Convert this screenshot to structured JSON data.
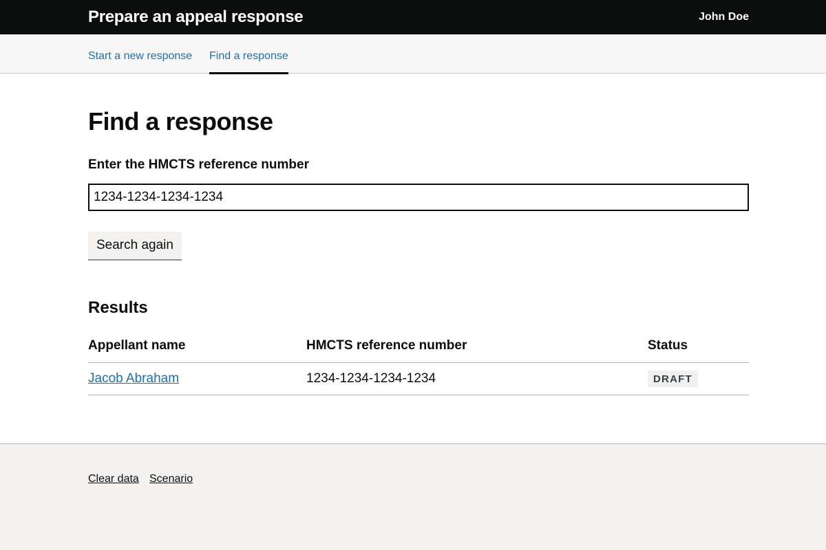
{
  "header": {
    "title": "Prepare an appeal response",
    "user_name": "John Doe"
  },
  "subnav": {
    "items": [
      {
        "label": "Start a new response",
        "active": false
      },
      {
        "label": "Find a response",
        "active": true
      }
    ]
  },
  "main": {
    "title": "Find a response",
    "search": {
      "label": "Enter the HMCTS reference number",
      "value": "1234-1234-1234-1234",
      "button_label": "Search again"
    },
    "results": {
      "heading": "Results",
      "columns": [
        "Appellant name",
        "HMCTS reference number",
        "Status"
      ],
      "rows": [
        {
          "name": "Jacob Abraham",
          "reference": "1234-1234-1234-1234",
          "status": "DRAFT"
        }
      ]
    }
  },
  "footer": {
    "links": [
      "Clear data",
      "Scenario"
    ]
  },
  "colors": {
    "header_bg": "#0b0c0c",
    "link": "#1d70b8",
    "footer_bg": "#f3f2f1",
    "tag_bg": "#f0f0f0",
    "tag_text": "#383f43"
  }
}
